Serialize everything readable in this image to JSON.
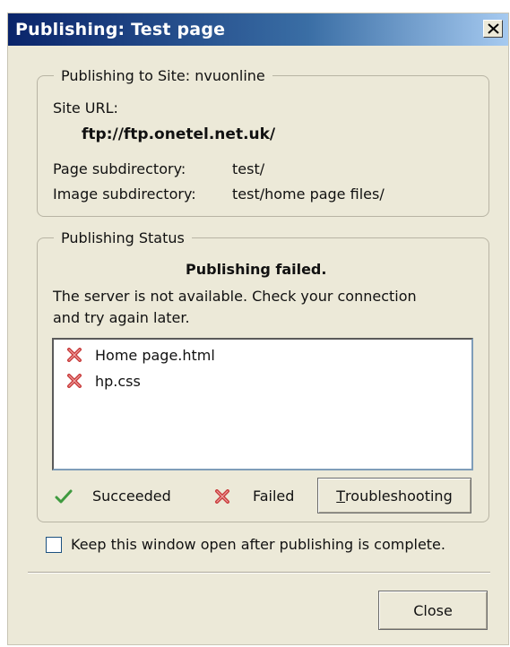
{
  "window": {
    "title": "Publishing: Test page"
  },
  "site_group": {
    "legend": "Publishing to Site: nvuonline",
    "site_url_label": "Site URL:",
    "site_url": "ftp://ftp.onetel.net.uk/",
    "page_subdir_label": "Page subdirectory:",
    "page_subdir": "test/",
    "image_subdir_label": "Image subdirectory:",
    "image_subdir": "test/home page files/"
  },
  "status_group": {
    "legend": "Publishing Status",
    "headline": "Publishing failed.",
    "message_line1": "The server is not available. Check your connection",
    "message_line2": "and try again later.",
    "files": [
      {
        "name": "Home page.html",
        "status": "failed",
        "icon": "failed-x-icon"
      },
      {
        "name": "hp.css",
        "status": "failed",
        "icon": "failed-x-icon"
      }
    ],
    "legend_succeeded": "Succeeded",
    "legend_failed": "Failed",
    "troubleshooting_prefix": "T",
    "troubleshooting_rest": "roubleshooting"
  },
  "keep_open": {
    "label": "Keep this window open after publishing is complete.",
    "checked": false
  },
  "buttons": {
    "close": "Close"
  },
  "colors": {
    "title_bar_start": "#0a246a",
    "failed_icon": "#c83c3c",
    "succeeded_icon": "#3f9a3f",
    "dialog_bg": "#ece9d8"
  }
}
